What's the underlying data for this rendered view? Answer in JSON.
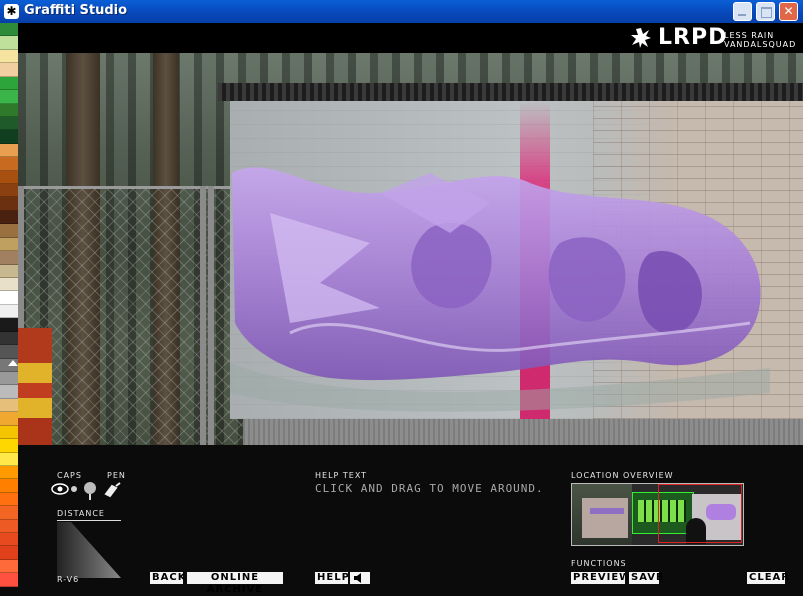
{
  "window": {
    "title": "Graffiti Studio"
  },
  "brand": {
    "logo": "LRPD",
    "sub_line1": "LESS RAIN",
    "sub_line2": "VANDALSQUAD"
  },
  "palette": {
    "selected_index": 25,
    "colors": [
      "#2e8b3a",
      "#bfe09a",
      "#f6e3a0",
      "#f2cfa0",
      "#2da53a",
      "#3bb54a",
      "#2f7a2a",
      "#1f5a2a",
      "#0f3f1f",
      "#e8a050",
      "#c86a20",
      "#a85010",
      "#8a4010",
      "#6a3010",
      "#4a2010",
      "#9a7040",
      "#c0a060",
      "#a08060",
      "#c8b890",
      "#e8e0c8",
      "#ffffff",
      "#f0f0f0",
      "#1a1a1a",
      "#333333",
      "#555555",
      "#777777",
      "#999999",
      "#bbbbbb",
      "#e6c07a",
      "#f0a830",
      "#f5c400",
      "#ffd700",
      "#ffe84a",
      "#ff9a00",
      "#ff8000",
      "#ff7010",
      "#f26522",
      "#ee5a24",
      "#e84a20",
      "#e0401a",
      "#ff6a3a",
      "#ff5040"
    ]
  },
  "tools": {
    "caps_label": "CAPS",
    "pen_label": "PEN",
    "distance_label": "DISTANCE",
    "version": "R-V6"
  },
  "help": {
    "label": "HELP TEXT",
    "text": "CLICK AND DRAG TO MOVE AROUND."
  },
  "overview": {
    "label": "LOCATION OVERVIEW"
  },
  "functions": {
    "label": "FUNCTIONS"
  },
  "buttons": {
    "back": "BACK",
    "online_archive": "ONLINE ARCHIVE",
    "help": "HELP",
    "preview": "PREVIEW",
    "save": "SAVE",
    "clear": "CLEAR"
  },
  "icons": {
    "app": "spray-splat-icon",
    "logo_mark": "splat-icon",
    "sound": "speaker-icon"
  },
  "colors": {
    "graffiti": "#a880d8",
    "accent_red": "#d22222"
  }
}
